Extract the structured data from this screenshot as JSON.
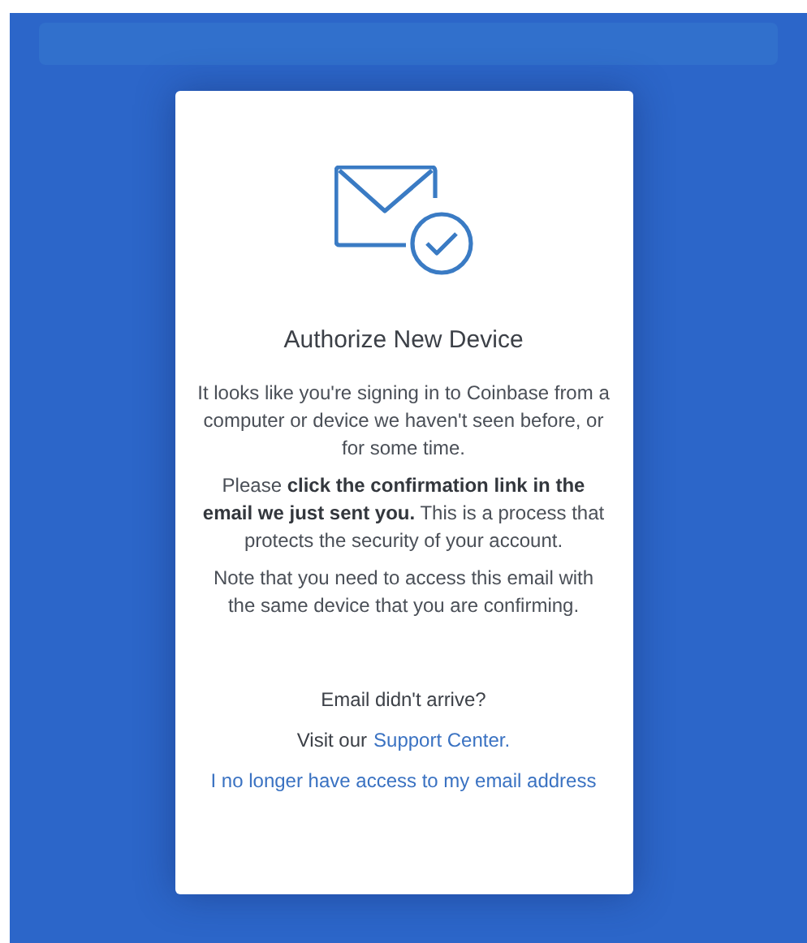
{
  "dialog": {
    "title": "Authorize New Device",
    "paragraphs": [
      "It looks like you're signing in to Coinbase from a computer or device we haven't seen before, or for some time.",
      "Please **click the confirmation link in the email we just sent you.** This is a process that protects the security of your account.",
      "Note that you need to access this email with the same device that you are confirming."
    ],
    "help_question": "Email didn't arrive?",
    "support_prefix": "Visit our",
    "support_link": "Support Center.",
    "no_access_link": "I no longer have access to my email address"
  }
}
